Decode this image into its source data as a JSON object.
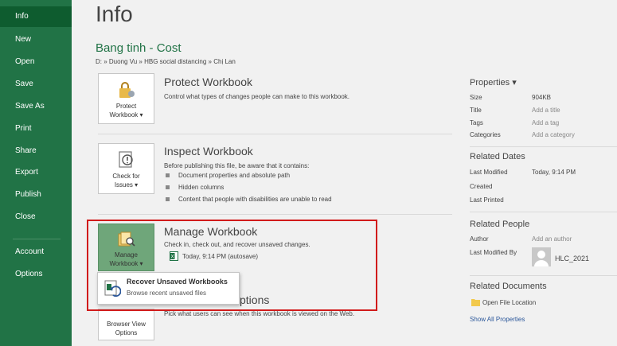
{
  "sidebar": {
    "items": [
      "Info",
      "New",
      "Open",
      "Save",
      "Save As",
      "Print",
      "Share",
      "Export",
      "Publish",
      "Close"
    ],
    "bottom_items": [
      "Account",
      "Options"
    ],
    "active": "Info"
  },
  "main": {
    "title": "Info",
    "workbook_name": "Bang tinh - Cost",
    "path": "D: » Duong Vu » HBG social distancing » Chị Lan"
  },
  "protect": {
    "tile_line1": "Protect",
    "tile_line2": "Workbook ▾",
    "title": "Protect Workbook",
    "desc": "Control what types of changes people can make to this workbook."
  },
  "inspect": {
    "tile_line1": "Check for",
    "tile_line2": "Issues ▾",
    "title": "Inspect Workbook",
    "desc": "Before publishing this file, be aware that it contains:",
    "bullets": [
      "Document properties and absolute path",
      "Hidden columns",
      "Content that people with disabilities are unable to read"
    ]
  },
  "manage": {
    "tile_line1": "Manage",
    "tile_line2": "Workbook ▾",
    "title": "Manage Workbook",
    "desc": "Check in, check out, and recover unsaved changes.",
    "autosave": "Today, 9:14 PM (autosave)"
  },
  "dropdown": {
    "title": "Recover Unsaved Workbooks",
    "subtitle": "Browse recent unsaved files"
  },
  "browser": {
    "tile_line1": "Browser View",
    "tile_line2": "Options",
    "title_partial": "ptions",
    "desc": "Pick what users can see when this workbook is viewed on the Web."
  },
  "properties": {
    "header": "Properties ▾",
    "rows": [
      {
        "label": "Size",
        "value": "904KB"
      },
      {
        "label": "Title",
        "value": "Add a title"
      },
      {
        "label": "Tags",
        "value": "Add a tag"
      },
      {
        "label": "Categories",
        "value": "Add a category"
      }
    ],
    "dates_header": "Related Dates",
    "dates": [
      {
        "label": "Last Modified",
        "value": "Today, 9:14 PM"
      },
      {
        "label": "Created",
        "value": ""
      },
      {
        "label": "Last Printed",
        "value": ""
      }
    ],
    "people_header": "Related People",
    "author_label": "Author",
    "author_value": "Add an author",
    "modified_by_label": "Last Modified By",
    "modified_by_value": "HLC_2021",
    "docs_header": "Related Documents",
    "open_location": "Open File Location",
    "show_all": "Show All Properties"
  },
  "colors": {
    "sidebar": "#217346",
    "sidebar_active": "#0e5c2f",
    "highlight": "#d11b1b",
    "accent_text": "#217346"
  }
}
